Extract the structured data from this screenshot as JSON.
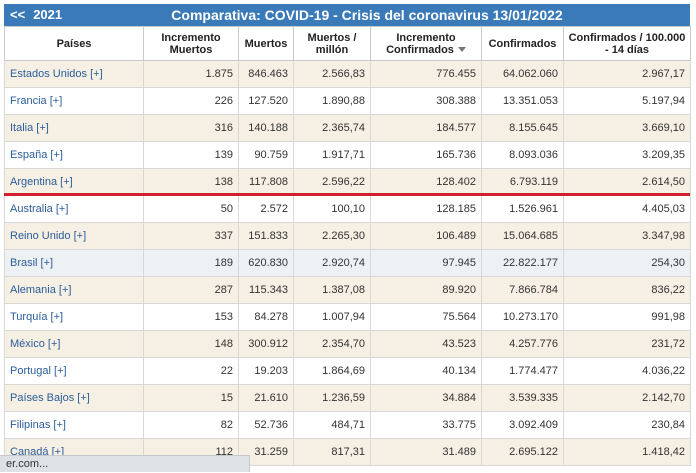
{
  "header": {
    "back_label": "<<",
    "year": "2021",
    "title": "Comparativa: COVID-19 - Crisis del coronavirus 13/01/2022"
  },
  "columns": [
    "Países",
    "Incremento Muertos",
    "Muertos",
    "Muertos / millón",
    "Incremento Confirmados",
    "Confirmados",
    "Confirmados / 100.000 - 14 días"
  ],
  "rows": [
    [
      "Estados Unidos [+]",
      "1.875",
      "846.463",
      "2.566,83",
      "776.455",
      "64.062.060",
      "2.967,17"
    ],
    [
      "Francia [+]",
      "226",
      "127.520",
      "1.890,88",
      "308.388",
      "13.351.053",
      "5.197,94"
    ],
    [
      "Italia [+]",
      "316",
      "140.188",
      "2.365,74",
      "184.577",
      "8.155.645",
      "3.669,10"
    ],
    [
      "España [+]",
      "139",
      "90.759",
      "1.917,71",
      "165.736",
      "8.093.036",
      "3.209,35"
    ],
    [
      "Argentina [+]",
      "138",
      "117.808",
      "2.596,22",
      "128.402",
      "6.793.119",
      "2.614,50"
    ],
    [
      "Australia [+]",
      "50",
      "2.572",
      "100,10",
      "128.185",
      "1.526.961",
      "4.405,03"
    ],
    [
      "Reino Unido [+]",
      "337",
      "151.833",
      "2.265,30",
      "106.489",
      "15.064.685",
      "3.347,98"
    ],
    [
      "Brasil [+]",
      "189",
      "620.830",
      "2.920,74",
      "97.945",
      "22.822.177",
      "254,30"
    ],
    [
      "Alemania [+]",
      "287",
      "115.343",
      "1.387,08",
      "89.920",
      "7.866.784",
      "836,22"
    ],
    [
      "Turquía [+]",
      "153",
      "84.278",
      "1.007,94",
      "75.564",
      "10.273.170",
      "991,98"
    ],
    [
      "México [+]",
      "148",
      "300.912",
      "2.354,70",
      "43.523",
      "4.257.776",
      "231,72"
    ],
    [
      "Portugal [+]",
      "22",
      "19.203",
      "1.864,69",
      "40.134",
      "1.774.477",
      "4.036,22"
    ],
    [
      "Países Bajos [+]",
      "15",
      "21.610",
      "1.236,59",
      "34.884",
      "3.539.335",
      "2.142,70"
    ],
    [
      "Filipinas [+]",
      "82",
      "52.736",
      "484,71",
      "33.775",
      "3.092.409",
      "230,84"
    ],
    [
      "Canadá [+]",
      "112",
      "31.259",
      "817,31",
      "31.489",
      "2.695.122",
      "1.418,42"
    ]
  ],
  "status_url": "er.com..."
}
